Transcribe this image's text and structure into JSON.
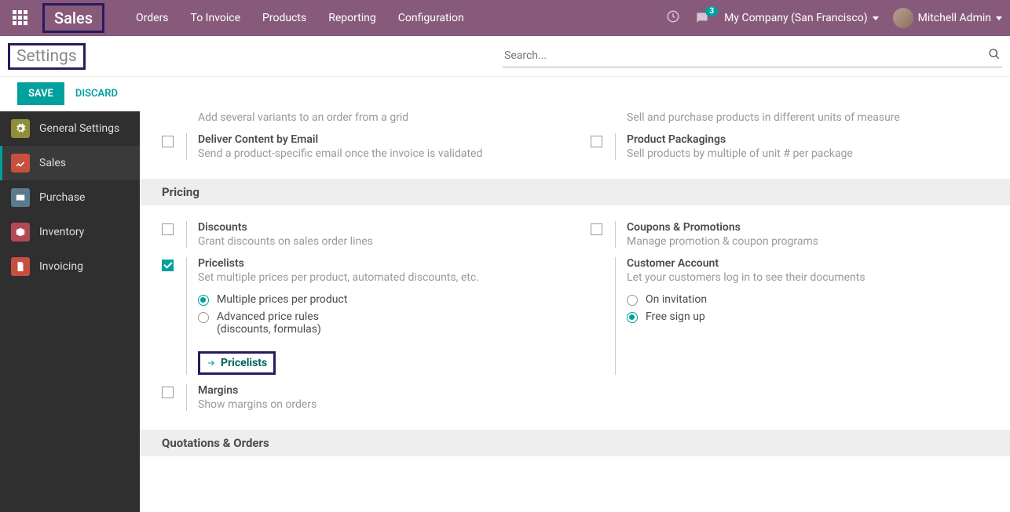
{
  "topnav": {
    "brand": "Sales",
    "links": [
      "Orders",
      "To Invoice",
      "Products",
      "Reporting",
      "Configuration"
    ],
    "msg_count": "3",
    "company": "My Company (San Francisco)",
    "user": "Mitchell Admin"
  },
  "page": {
    "title": "Settings",
    "search_placeholder": "Search...",
    "save": "SAVE",
    "discard": "DISCARD"
  },
  "sidebar": {
    "items": [
      {
        "label": "General Settings",
        "color": "#8f8f3a"
      },
      {
        "label": "Sales",
        "color": "#c74f3e"
      },
      {
        "label": "Purchase",
        "color": "#5b7a8c"
      },
      {
        "label": "Inventory",
        "color": "#b24a56"
      },
      {
        "label": "Invoicing",
        "color": "#c74f3e"
      }
    ]
  },
  "partial_top": {
    "left_desc": "Add several variants to an order from a grid",
    "right_desc": "Sell and purchase products in different units of measure",
    "left2_title": "Deliver Content by Email",
    "left2_desc": "Send a product-specific email once the invoice is validated",
    "right2_title": "Product Packagings",
    "right2_desc": "Sell products by multiple of unit # per package"
  },
  "sections": {
    "pricing": "Pricing",
    "quotations": "Quotations & Orders"
  },
  "pricing": {
    "discounts_title": "Discounts",
    "discounts_desc": "Grant discounts on sales order lines",
    "coupons_title": "Coupons & Promotions",
    "coupons_desc": "Manage promotion & coupon programs",
    "pricelists_title": "Pricelists",
    "pricelists_desc": "Set multiple prices per product, automated discounts, etc.",
    "radio_multiple": "Multiple prices per product",
    "radio_advanced": "Advanced price rules",
    "radio_advanced2": "(discounts, formulas)",
    "pricelists_link": "Pricelists",
    "customer_title": "Customer Account",
    "customer_desc": "Let your customers log in to see their documents",
    "radio_invitation": "On invitation",
    "radio_freesignup": "Free sign up",
    "margins_title": "Margins",
    "margins_desc": "Show margins on orders"
  }
}
